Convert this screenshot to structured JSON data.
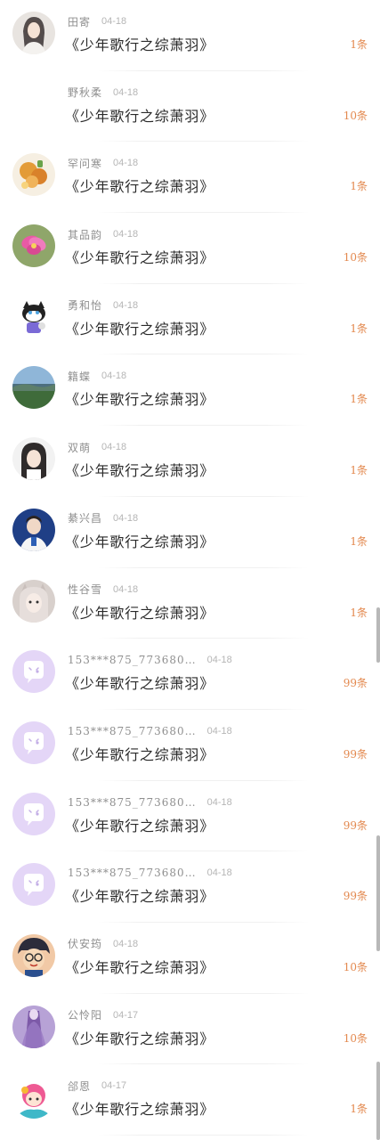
{
  "rows": [
    {
      "name": "田寄",
      "date": "04-18",
      "title": "《少年歌行之综萧羽》",
      "count": "1条",
      "avatar": "girl-portrait-icon"
    },
    {
      "name": "野秋柔",
      "date": "04-18",
      "title": "《少年歌行之综萧羽》",
      "count": "10条",
      "avatar": "blank-avatar"
    },
    {
      "name": "罕问寒",
      "date": "04-18",
      "title": "《少年歌行之综萧羽》",
      "count": "1条",
      "avatar": "food-photo-icon"
    },
    {
      "name": "其品韵",
      "date": "04-18",
      "title": "《少年歌行之综萧羽》",
      "count": "10条",
      "avatar": "pink-flower-icon"
    },
    {
      "name": "勇和怡",
      "date": "04-18",
      "title": "《少年歌行之综萧羽》",
      "count": "1条",
      "avatar": "cartoon-cat-icon"
    },
    {
      "name": "籍蝶",
      "date": "04-18",
      "title": "《少年歌行之综萧羽》",
      "count": "1条",
      "avatar": "landscape-icon"
    },
    {
      "name": "双萌",
      "date": "04-18",
      "title": "《少年歌行之综萧羽》",
      "count": "1条",
      "avatar": "girl-photo-icon"
    },
    {
      "name": "綦兴昌",
      "date": "04-18",
      "title": "《少年歌行之综萧羽》",
      "count": "1条",
      "avatar": "boy-photo-icon"
    },
    {
      "name": "性谷雪",
      "date": "04-18",
      "title": "《少年歌行之综萧羽》",
      "count": "1条",
      "avatar": "cat-ear-girl-icon"
    },
    {
      "name": "153***875_773680…",
      "date": "04-18",
      "title": "《少年歌行之综萧羽》",
      "count": "99条",
      "avatar": "default-chat-bubble-icon"
    },
    {
      "name": "153***875_773680…",
      "date": "04-18",
      "title": "《少年歌行之综萧羽》",
      "count": "99条",
      "avatar": "default-chat-bubble-icon"
    },
    {
      "name": "153***875_773680…",
      "date": "04-18",
      "title": "《少年歌行之综萧羽》",
      "count": "99条",
      "avatar": "default-chat-bubble-icon"
    },
    {
      "name": "153***875_773680…",
      "date": "04-18",
      "title": "《少年歌行之综萧羽》",
      "count": "99条",
      "avatar": "default-chat-bubble-icon"
    },
    {
      "name": "伏安筠",
      "date": "04-18",
      "title": "《少年歌行之综萧羽》",
      "count": "10条",
      "avatar": "anime-boy-glasses-icon"
    },
    {
      "name": "公怜阳",
      "date": "04-17",
      "title": "《少年歌行之综萧羽》",
      "count": "10条",
      "avatar": "purple-dress-icon"
    },
    {
      "name": "郃恩",
      "date": "04-17",
      "title": "《少年歌行之综萧羽》",
      "count": "1条",
      "avatar": "pink-hair-cartoon-icon"
    }
  ],
  "colors": {
    "count": "#e3894f",
    "title": "#2a2a2a",
    "username": "#8f8f8f",
    "date": "#b5b5b5",
    "default_avatar": "#e4d6f7"
  }
}
